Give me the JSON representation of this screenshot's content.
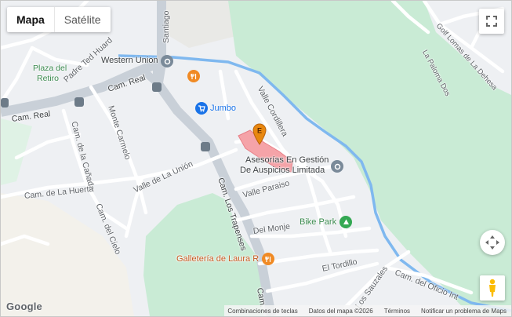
{
  "map_type": {
    "map": "Mapa",
    "satellite": "Satélite"
  },
  "labels": {
    "plaza_retiro_1": "Plaza del",
    "plaza_retiro_2": "Retiro",
    "padre_ted": "Padre Ted Huard",
    "santiago": "Santiago",
    "cam_real_1": "Cam. Real",
    "cam_real_2": "Cam. Real",
    "monte_carmelo": "Monte Carmelo",
    "cam_canada": "Cam. de la Cañada",
    "valle_union": "Valle de La Unión",
    "cam_huerta": "Cam. de La Huerta",
    "cam_cielo": "Cam. del Cielo",
    "cam_trapenses": "Cam. Los Trapenses",
    "cam_bottom": "Cam.",
    "valle_cordillera": "Valle Cordillera",
    "valle_paraiso": "Valle Paraiso",
    "del_monje": "Del Monje",
    "el_tordillo": "El Tordillo",
    "los_sauzales": "Los Sauzales",
    "cam_oficio": "Cam. del Oficio Int",
    "golf_lomas": "Golf Lomas de La Dehesa",
    "la_paloma": "La Paloma Dos"
  },
  "pois": {
    "western_union": "Western Union",
    "jumbo": "Jumbo",
    "asesorias_1": "Asesorías En Gestión",
    "asesorias_2": "De Auspicios Limitada",
    "bike_park": "Bike Park",
    "galleteria": "Galletería de Laura R"
  },
  "marker_letter": "E",
  "footer": {
    "shortcuts": "Combinaciones de teclas",
    "map_data": "Datos del mapa ©2026",
    "terms": "Términos",
    "report": "Notificar un problema de Maps"
  },
  "logo": "Google",
  "icons": {
    "fullscreen": "fullscreen-icon",
    "pan": "pan-control-icon",
    "pegman": "street-view-pegman-icon"
  },
  "colors": {
    "park_green": "#c9ebd5",
    "highlight_red": "#f5a3a8",
    "marker_orange": "#e8870f",
    "river_blue": "#7fb8ef"
  }
}
